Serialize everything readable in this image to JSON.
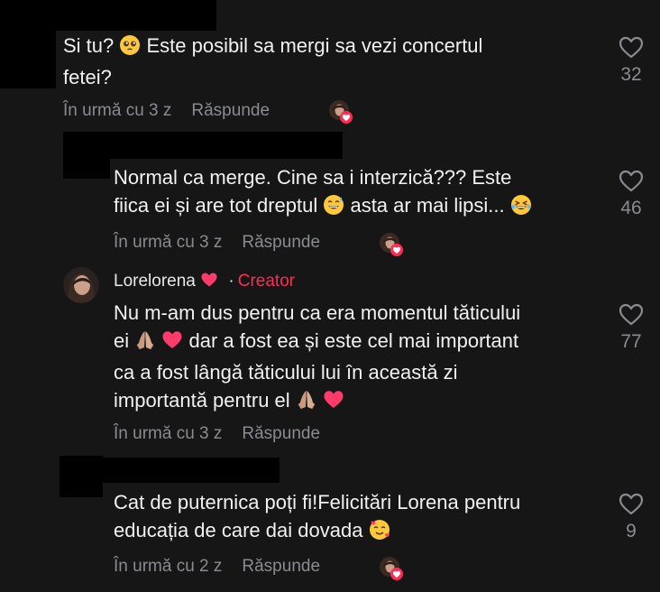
{
  "comments": [
    {
      "lines": [
        "Si tu? {E} Este posibil sa mergi sa vezi concertul",
        "fetei?"
      ],
      "emojis": [
        "pleading-face"
      ],
      "time": "În urmă cu 3 z",
      "reply_label": "Răspunde",
      "likes": "32"
    },
    {
      "lines": [
        "Normal ca merge. Cine sa i interzică??? Este",
        "fiica ei și are tot dreptul {E} asta ar mai lipsi... {E}"
      ],
      "emojis": [
        "grinning-sweat-face",
        "laughing-face"
      ],
      "time": "În urmă cu 3 z",
      "reply_label": "Răspunde",
      "likes": "46"
    },
    {
      "author": "Lorelorena",
      "author_badge": "Creator",
      "lines": [
        "Nu m-am dus pentru ca era momentul tăticului",
        "ei {E} {E} dar a fost ea și este cel mai important",
        "ca a fost lângă tăticului lui în această zi",
        "importantă pentru el {E} {E}"
      ],
      "emojis": [
        "folded-hands",
        "heart",
        "folded-hands",
        "heart"
      ],
      "time": "În urmă cu 3 z",
      "reply_label": "Răspunde",
      "likes": "77"
    },
    {
      "lines": [
        "Cat de puternica poți fi!Felicitări Lorena pentru",
        "educația de care dai dovada {E}"
      ],
      "emojis": [
        "smiling-face-with-hearts"
      ],
      "time": "În urmă cu 2 z",
      "reply_label": "Răspunde",
      "likes": "9"
    }
  ],
  "colors": {
    "background": "#161616",
    "text": "#f1f1f2",
    "muted": "#8a8b91",
    "accent": "#fe2c55"
  }
}
